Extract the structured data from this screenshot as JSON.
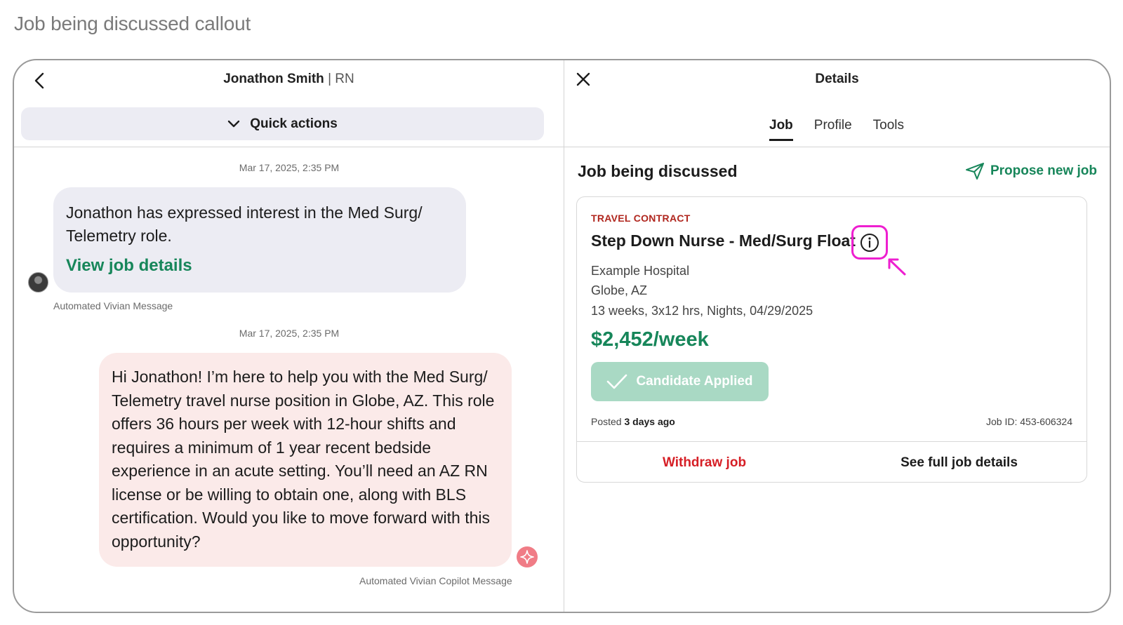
{
  "page_title": "Job being discussed callout",
  "chat": {
    "contact_name": "Jonathon Smith",
    "separator": "|",
    "contact_role": "RN",
    "quick_actions_label": "Quick actions",
    "messages": [
      {
        "timestamp": "Mar 17, 2025, 2:35 PM",
        "text": "Jonathon has expressed interest in the Med Surg/ Telemetry role.",
        "link": "View job details",
        "caption": "Automated Vivian Message"
      },
      {
        "timestamp": "Mar 17, 2025, 2:35 PM",
        "text": "Hi Jonathon! I’m here to help you with the Med Surg/ Telemetry travel nurse position in Globe, AZ. This role offers 36 hours per week with 12-hour shifts and requires a minimum of 1 year recent bedside experience in an acute setting. You’ll need an AZ RN license or be willing to obtain one, along with BLS certification. Would you like to move forward with this opportunity?",
        "caption": "Automated Vivian Copilot Message"
      }
    ]
  },
  "details": {
    "title": "Details",
    "tabs": [
      {
        "label": "Job",
        "active": true
      },
      {
        "label": "Profile",
        "active": false
      },
      {
        "label": "Tools",
        "active": false
      }
    ],
    "section_title": "Job being discussed",
    "propose_label": "Propose new job",
    "job": {
      "type": "TRAVEL CONTRACT",
      "title": "Step Down Nurse - Med/Surg Float",
      "facility": "Example Hospital",
      "location": "Globe, AZ",
      "schedule": "13 weeks, 3x12 hrs, Nights, 04/29/2025",
      "pay": "$2,452/week",
      "status_button": "Candidate Applied",
      "posted_prefix": "Posted",
      "posted_value": "3 days ago",
      "job_id": "Job ID: 453-606324",
      "withdraw_label": "Withdraw job",
      "full_details_label": "See full job details"
    }
  },
  "colors": {
    "accent_green": "#17865a",
    "danger_red": "#d61f26",
    "callout_magenta": "#ee1fd0",
    "copilot_bubble": "#fbeae9",
    "user_bubble": "#ececf3"
  },
  "icons": [
    "chevron-left-icon",
    "chevron-down-icon",
    "close-icon",
    "send-icon",
    "info-icon",
    "check-icon",
    "sparkle-icon",
    "arrow-icon"
  ]
}
